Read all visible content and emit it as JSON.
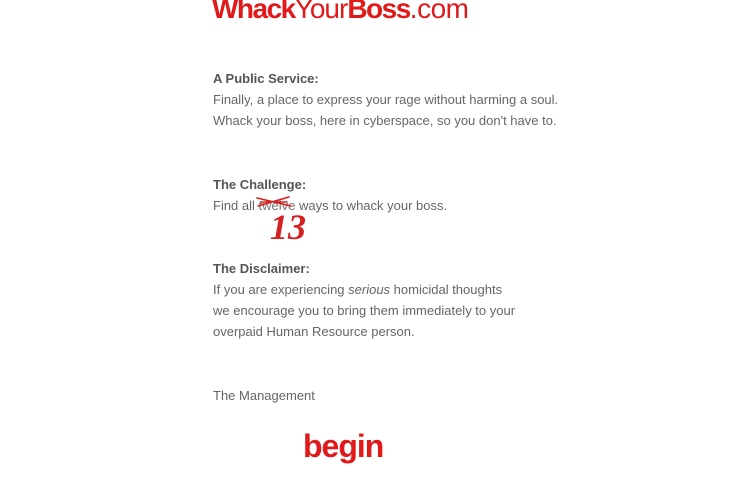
{
  "logo": {
    "whack": "Whack",
    "your": "Your",
    "boss": "Boss",
    "com": ".com"
  },
  "public_service": {
    "heading": "A Public Service:",
    "line1": "Finally, a place to express your rage without harming a soul.",
    "line2": "Whack your boss, here in cyberspace, so you don't have to."
  },
  "challenge": {
    "heading": "The Challenge:",
    "before": "Find all ",
    "struck_word": "twelve",
    "after": " ways to whack your boss.",
    "correction": "13"
  },
  "disclaimer": {
    "heading": "The Disclaimer:",
    "line1_before": "If you are experiencing ",
    "line1_emphasis": "serious",
    "line1_after": " homicidal thoughts",
    "line2": "we encourage you to bring them immediately to your",
    "line3": "overpaid Human Resource person."
  },
  "signature": "The Management",
  "begin_label": "begin",
  "colors": {
    "brand_red": "#e01a1a",
    "text_gray": "#666666"
  }
}
